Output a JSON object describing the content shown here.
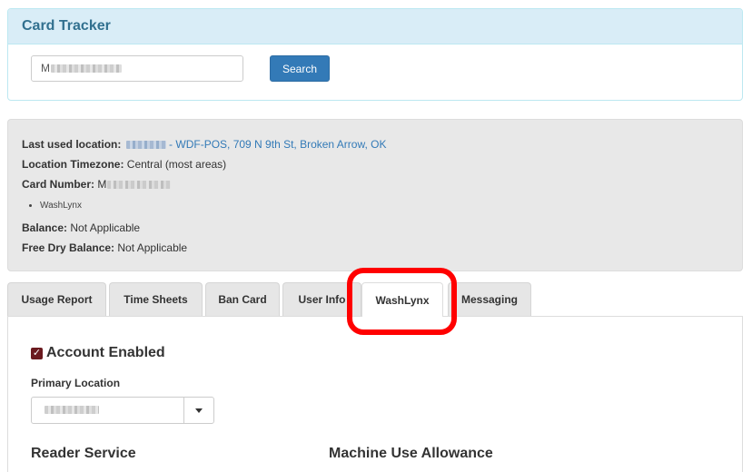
{
  "header": {
    "title": "Card Tracker"
  },
  "search": {
    "value_prefix": "M",
    "button_label": "Search"
  },
  "info": {
    "last_used_label": "Last used location:",
    "last_used_value": "- WDF-POS, 709 N 9th St, Broken Arrow, OK",
    "timezone_label": "Location Timezone:",
    "timezone_value": "Central (most areas)",
    "card_number_label": "Card Number:",
    "card_number_prefix": "M",
    "list_items": [
      "WashLynx"
    ],
    "balance_label": "Balance:",
    "balance_value": "Not Applicable",
    "free_dry_label": "Free Dry Balance:",
    "free_dry_value": "Not Applicable"
  },
  "tabs": [
    {
      "label": "Usage Report"
    },
    {
      "label": "Time Sheets"
    },
    {
      "label": "Ban Card"
    },
    {
      "label": "User Info"
    },
    {
      "label": "WashLynx",
      "active": true
    },
    {
      "label": "Messaging"
    }
  ],
  "form": {
    "account_enabled_label": "Account Enabled",
    "account_enabled_checked": true,
    "primary_location_label": "Primary Location",
    "reader_service_label": "Reader Service",
    "machine_use_label": "Machine Use Allowance"
  },
  "colors": {
    "accent": "#337ab7",
    "header_bg": "#d9edf7",
    "header_text": "#31708f",
    "highlight": "#ff0000",
    "checkbox": "#6b1a1f"
  }
}
